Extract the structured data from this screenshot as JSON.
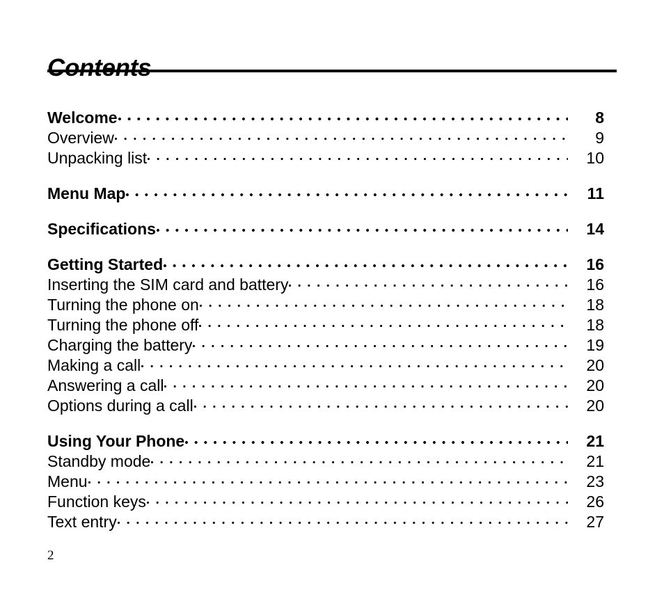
{
  "document": {
    "title": "Contents",
    "folio": "2"
  },
  "toc": {
    "entries": [
      {
        "label": "Welcome",
        "page": "8",
        "level": "chapter"
      },
      {
        "label": "Overview",
        "page": "9",
        "level": "section"
      },
      {
        "label": "Unpacking list",
        "page": "10",
        "level": "section"
      },
      {
        "label": "Menu Map",
        "page": "11",
        "level": "chapter"
      },
      {
        "label": "Specifications",
        "page": "14",
        "level": "chapter"
      },
      {
        "label": "Getting Started",
        "page": "16",
        "level": "chapter"
      },
      {
        "label": "Inserting the SIM card and battery",
        "page": "16",
        "level": "section"
      },
      {
        "label": "Turning the phone on",
        "page": "18",
        "level": "section"
      },
      {
        "label": "Turning the phone off",
        "page": "18",
        "level": "section"
      },
      {
        "label": "Charging the battery",
        "page": "19",
        "level": "section"
      },
      {
        "label": "Making a call",
        "page": "20",
        "level": "section"
      },
      {
        "label": "Answering a call",
        "page": "20",
        "level": "section"
      },
      {
        "label": "Options during a call",
        "page": "20",
        "level": "section"
      },
      {
        "label": "Using Your Phone",
        "page": "21",
        "level": "chapter"
      },
      {
        "label": "Standby mode",
        "page": "21",
        "level": "section"
      },
      {
        "label": "Menu",
        "page": "23",
        "level": "section"
      },
      {
        "label": "Function keys",
        "page": "26",
        "level": "section"
      },
      {
        "label": "Text entry",
        "page": "27",
        "level": "section"
      }
    ]
  },
  "colors": {
    "text": "#000000",
    "background": "#ffffff",
    "rule": "#000000"
  }
}
